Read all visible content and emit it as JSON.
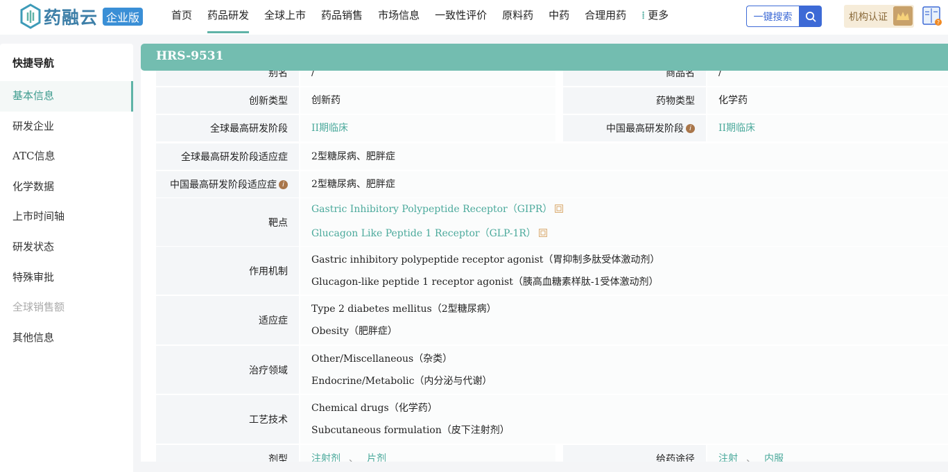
{
  "brand": {
    "name": "药融云",
    "badge": "企业版"
  },
  "nav": {
    "items": [
      {
        "label": "首页",
        "active": false
      },
      {
        "label": "药品研发",
        "active": true
      },
      {
        "label": "全球上市",
        "active": false
      },
      {
        "label": "药品销售",
        "active": false
      },
      {
        "label": "市场信息",
        "active": false
      },
      {
        "label": "一致性评价",
        "active": false
      },
      {
        "label": "原料药",
        "active": false
      },
      {
        "label": "中药",
        "active": false
      },
      {
        "label": "合理用药",
        "active": false
      }
    ],
    "more_label": "更多",
    "search_label": "一键搜索",
    "org_cert_label": "机构认证"
  },
  "sidebar": {
    "title": "快捷导航",
    "items": [
      {
        "label": "基本信息",
        "state": "active"
      },
      {
        "label": "研发企业",
        "state": "normal"
      },
      {
        "label": "ATC信息",
        "state": "normal"
      },
      {
        "label": "化学数据",
        "state": "normal"
      },
      {
        "label": "上市时间轴",
        "state": "normal"
      },
      {
        "label": "研发状态",
        "state": "normal"
      },
      {
        "label": "特殊审批",
        "state": "normal"
      },
      {
        "label": "全球销售额",
        "state": "disabled"
      },
      {
        "label": "其他信息",
        "state": "normal"
      }
    ]
  },
  "drug": {
    "title": "HRS-9531",
    "alias_label": "别名",
    "alias_value": "/",
    "trade_name_label": "商品名",
    "trade_name_value": "/",
    "innovation_label": "创新类型",
    "innovation_value": "创新药",
    "drug_type_label": "药物类型",
    "drug_type_value": "化学药",
    "global_stage_label": "全球最高研发阶段",
    "global_stage_value": "II期临床",
    "china_stage_label": "中国最高研发阶段",
    "china_stage_value": "II期临床",
    "global_indication_label": "全球最高研发阶段适应症",
    "global_indication_value": "2型糖尿病、肥胖症",
    "china_indication_label": "中国最高研发阶段适应症",
    "china_indication_value": "2型糖尿病、肥胖症",
    "target_label": "靶点",
    "targets": [
      "Gastric Inhibitory Polypeptide Receptor（GIPR）",
      "Glucagon Like Peptide 1 Receptor（GLP-1R）"
    ],
    "mechanism_label": "作用机制",
    "mechanisms": [
      "Gastric inhibitory polypeptide receptor agonist（胃抑制多肽受体激动剂）",
      "Glucagon-like peptide 1 receptor agonist（胰高血糖素样肽-1受体激动剂）"
    ],
    "indication_label": "适应症",
    "indications": [
      "Type 2 diabetes mellitus（2型糖尿病）",
      "Obesity（肥胖症）"
    ],
    "therapy_label": "治疗领域",
    "therapies": [
      "Other/Miscellaneous（杂类）",
      "Endocrine/Metabolic（内分泌与代谢）"
    ],
    "tech_label": "工艺技术",
    "techs": [
      "Chemical drugs（化学药）",
      "Subcutaneous formulation（皮下注射剂）"
    ],
    "dosage_label": "剂型",
    "dosages": [
      "注射剂",
      "片剂"
    ],
    "route_label": "给药途径",
    "routes": [
      "注射",
      "内服"
    ],
    "separator": "、",
    "info_glyph": "i"
  },
  "colors": {
    "accent": "#5fb3a7",
    "title_bar": "#73bdb0",
    "link": "#4aa99b",
    "search": "#3d6ad6"
  }
}
